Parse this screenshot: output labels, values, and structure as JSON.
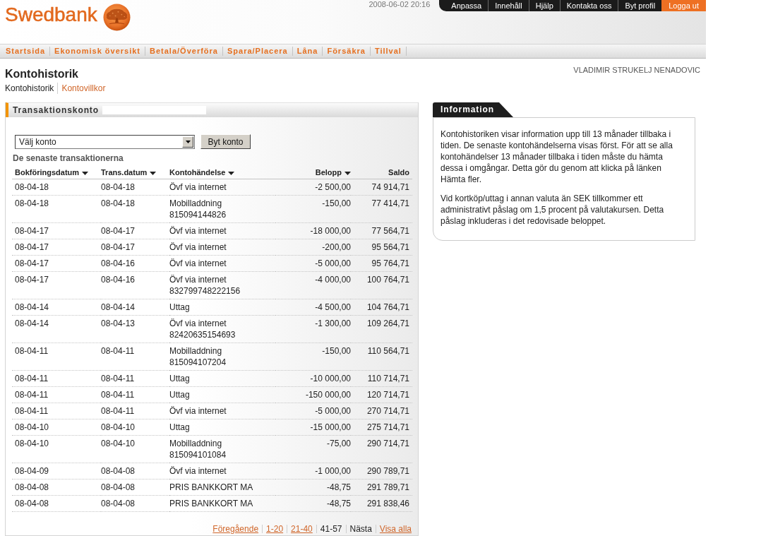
{
  "header": {
    "logo_text": "Swedbank",
    "datetime": "2008-06-02 20:16",
    "utility_links": [
      {
        "label": "Anpassa",
        "kind": "link"
      },
      {
        "label": "Innehåll",
        "kind": "link"
      },
      {
        "label": "Hjälp",
        "kind": "link"
      },
      {
        "label": "Kontakta oss",
        "kind": "link"
      },
      {
        "label": "Byt profil",
        "kind": "link"
      },
      {
        "label": "Logga ut",
        "kind": "logout"
      }
    ]
  },
  "main_nav": [
    {
      "label": "Startsida"
    },
    {
      "label": "Ekonomisk översikt"
    },
    {
      "label": "Betala/Överföra"
    },
    {
      "label": "Spara/Placera"
    },
    {
      "label": "Låna"
    },
    {
      "label": "Försäkra"
    },
    {
      "label": "Tillval"
    }
  ],
  "page": {
    "title": "Kontohistorik",
    "user_name": "VLADIMIR STRUKELJ NENADOVIC",
    "subtabs": [
      {
        "label": "Kontohistorik",
        "selected": true
      },
      {
        "label": "Kontovillkor",
        "selected": false
      }
    ]
  },
  "account_panel": {
    "title": "Transaktionskonto",
    "account_select": {
      "value": "Välj konto"
    },
    "change_button": "Byt konto",
    "section_title": "De senaste transaktionerna",
    "table": {
      "columns": [
        {
          "label": "Bokföringsdatum",
          "sortable": true
        },
        {
          "label": "Trans.datum",
          "sortable": true
        },
        {
          "label": "Kontohändelse",
          "sortable": true
        },
        {
          "label": "Belopp",
          "sortable": true
        },
        {
          "label": "Saldo",
          "sortable": false
        }
      ],
      "rows": [
        {
          "booking_date": "08-04-18",
          "trans_date": "08-04-18",
          "event": "Övf via internet",
          "amount": "-2 500,00",
          "balance": "74 914,71"
        },
        {
          "booking_date": "08-04-18",
          "trans_date": "08-04-18",
          "event": "Mobilladdning",
          "reference": "815094144826",
          "amount": "-150,00",
          "balance": "77 414,71"
        },
        {
          "booking_date": "08-04-17",
          "trans_date": "08-04-17",
          "event": "Övf via internet",
          "amount": "-18 000,00",
          "balance": "77 564,71"
        },
        {
          "booking_date": "08-04-17",
          "trans_date": "08-04-17",
          "event": "Övf via internet",
          "amount": "-200,00",
          "balance": "95 564,71"
        },
        {
          "booking_date": "08-04-17",
          "trans_date": "08-04-16",
          "event": "Övf via internet",
          "amount": "-5 000,00",
          "balance": "95 764,71"
        },
        {
          "booking_date": "08-04-17",
          "trans_date": "08-04-16",
          "event": "Övf via internet",
          "reference": "832799748222156",
          "amount": "-4 000,00",
          "balance": "100 764,71"
        },
        {
          "booking_date": "08-04-14",
          "trans_date": "08-04-14",
          "event": "Uttag",
          "amount": "-4 500,00",
          "balance": "104 764,71"
        },
        {
          "booking_date": "08-04-14",
          "trans_date": "08-04-13",
          "event": "Övf via internet",
          "reference": "82420635154693",
          "amount": "-1 300,00",
          "balance": "109 264,71"
        },
        {
          "booking_date": "08-04-11",
          "trans_date": "08-04-11",
          "event": "Mobilladdning",
          "reference": "815094107204",
          "amount": "-150,00",
          "balance": "110 564,71"
        },
        {
          "booking_date": "08-04-11",
          "trans_date": "08-04-11",
          "event": "Uttag",
          "amount": "-10 000,00",
          "balance": "110 714,71"
        },
        {
          "booking_date": "08-04-11",
          "trans_date": "08-04-11",
          "event": "Uttag",
          "amount": "-150 000,00",
          "balance": "120 714,71"
        },
        {
          "booking_date": "08-04-11",
          "trans_date": "08-04-11",
          "event": "Övf via internet",
          "amount": "-5 000,00",
          "balance": "270 714,71"
        },
        {
          "booking_date": "08-04-10",
          "trans_date": "08-04-10",
          "event": "Uttag",
          "amount": "-15 000,00",
          "balance": "275 714,71"
        },
        {
          "booking_date": "08-04-10",
          "trans_date": "08-04-10",
          "event": "Mobilladdning",
          "reference": "815094101084",
          "amount": "-75,00",
          "balance": "290 714,71"
        },
        {
          "booking_date": "08-04-09",
          "trans_date": "08-04-08",
          "event": "Övf via internet",
          "amount": "-1 000,00",
          "balance": "290 789,71"
        },
        {
          "booking_date": "08-04-08",
          "trans_date": "08-04-08",
          "event": "PRIS BANKKORT MA",
          "amount": "-48,75",
          "balance": "291 789,71"
        },
        {
          "booking_date": "08-04-08",
          "trans_date": "08-04-08",
          "event": "PRIS BANKKORT MA",
          "amount": "-48,75",
          "balance": "291 838,46"
        }
      ]
    },
    "pagination": {
      "previous": {
        "label": "Föregående",
        "disabled": false
      },
      "pages": [
        {
          "label": "1-20",
          "selected": false
        },
        {
          "label": "21-40",
          "selected": false
        },
        {
          "label": "41-57",
          "selected": true
        }
      ],
      "next": {
        "label": "Nästa",
        "disabled": true
      },
      "show_all": "Visa alla"
    }
  },
  "info_panel": {
    "title": "Information",
    "paragraphs": [
      "Kontohistoriken visar information upp till 13 månader tillbaka i tiden. De senaste kontohändelserna visas först. För att se alla kontohändelser 13 månader tillbaka i tiden måste du hämta dessa i omgångar. Detta gör du genom att klicka på länken Hämta fler.",
      "Vid kortköp/uttag i annan valuta än SEK tillkommer ett administrativt påslag om 1,5 procent på valutakursen. Detta påslag inkluderas i det redovisade beloppet."
    ]
  }
}
